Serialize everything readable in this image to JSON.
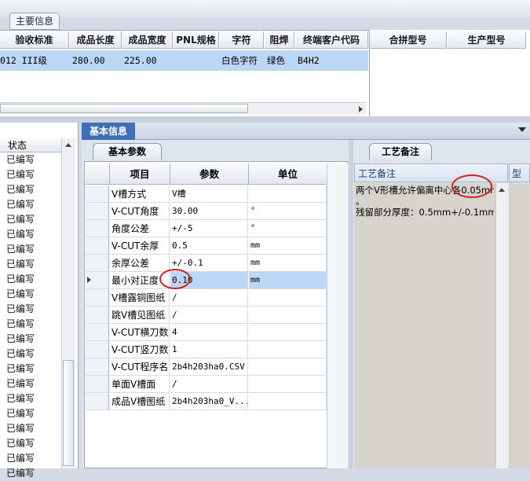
{
  "main_tab": "主要信息",
  "top_grid": {
    "headers": [
      "验收标准",
      "成品长度",
      "成品宽度",
      "PNL规格",
      "字符",
      "阻焊",
      "终端客户代码"
    ],
    "row": [
      "012 III级",
      "280.00",
      "225.00",
      "",
      "白色字符",
      "绿色",
      "B4H2"
    ]
  },
  "right_top_headers": [
    "合拼型号",
    "生产型号"
  ],
  "left_list": {
    "header": "状态",
    "items": [
      "已编写",
      "已编写",
      "已编写",
      "已编写",
      "已编写",
      "已编写",
      "已编写",
      "已编写",
      "已编写",
      "已编写",
      "已编写",
      "已编写",
      "已编写",
      "已编写",
      "已编写",
      "已编写",
      "已编写",
      "已编写",
      "已编写",
      "已编写",
      "已编写",
      "已编写"
    ]
  },
  "basic_info_tab": "基本信息",
  "param_tab": "基本参数",
  "param_grid": {
    "headers": [
      "项目",
      "参数",
      "单位"
    ],
    "rows": [
      {
        "item": "V槽方式",
        "param": "V槽",
        "unit": ""
      },
      {
        "item": "V-CUT角度",
        "param": "30.00",
        "unit": "°"
      },
      {
        "item": "角度公差",
        "param": "+/-5",
        "unit": "°"
      },
      {
        "item": "V-CUT余厚",
        "param": "0.5",
        "unit": "mm"
      },
      {
        "item": "余厚公差",
        "param": "+/-0.1",
        "unit": "mm"
      },
      {
        "item": "最小对正度",
        "param": "0.10",
        "unit": "mm"
      },
      {
        "item": "V槽露铜图纸",
        "param": "/",
        "unit": ""
      },
      {
        "item": "跳V槽见图纸",
        "param": "/",
        "unit": ""
      },
      {
        "item": "V-CUT横刀数",
        "param": "4",
        "unit": ""
      },
      {
        "item": "V-CUT竖刀数",
        "param": "1",
        "unit": ""
      },
      {
        "item": "V-CUT程序名",
        "param": "2b4h203ha0.CSV",
        "unit": ""
      },
      {
        "item": "单面V槽面",
        "param": "/",
        "unit": ""
      },
      {
        "item": "成品V槽图纸",
        "param": "2b4h203ha0_V...",
        "unit": ""
      }
    ]
  },
  "notes_tab": "工艺备注",
  "notes_header": "工艺备注",
  "notes_header2": "型",
  "notes_text": [
    "两个V形槽允许偏离中心各0.05mm",
    "。",
    "残留部分厚度：0.5mm+/-0.1mm。"
  ],
  "colors": {
    "accent": "#3e6fb7",
    "selection": "#bcd7f6",
    "highlight_circle": "#d42020"
  }
}
